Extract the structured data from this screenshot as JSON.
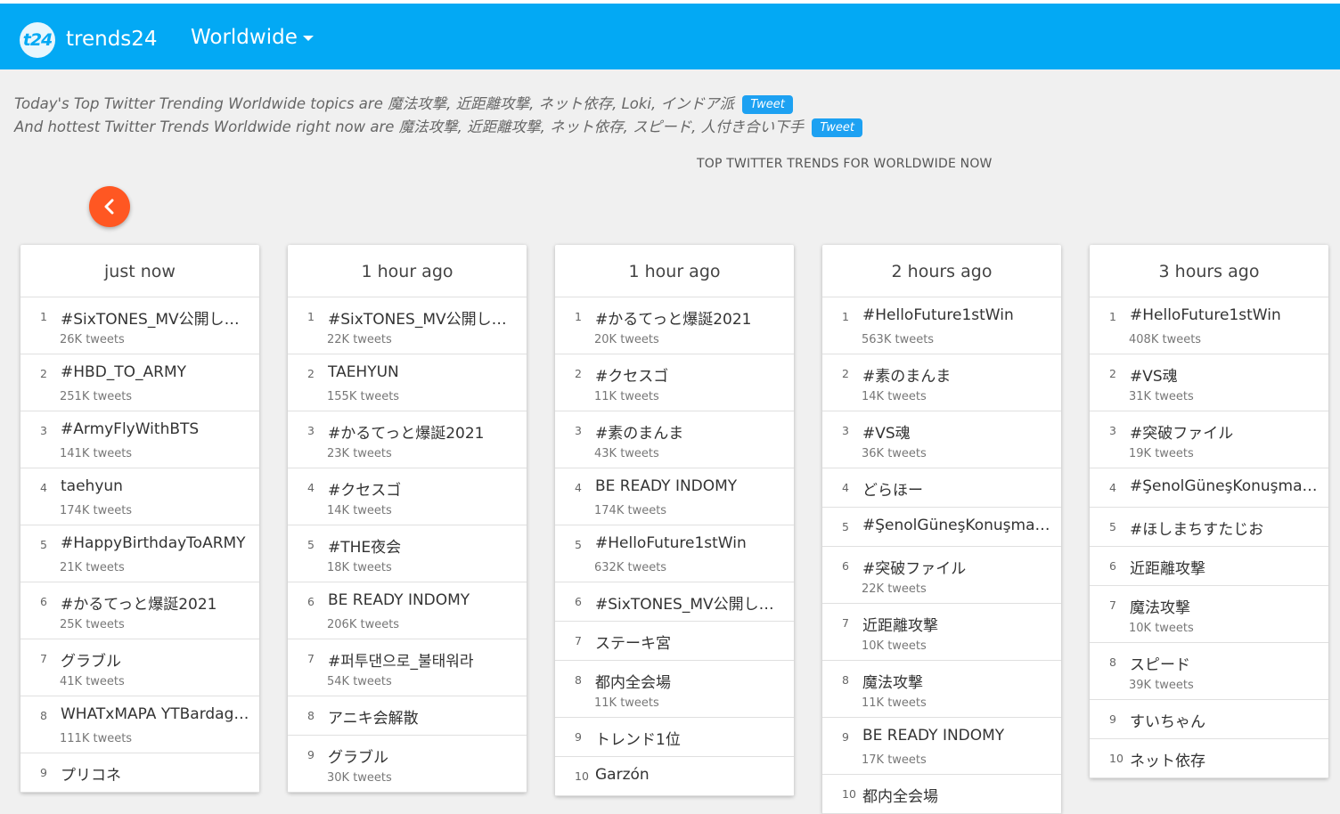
{
  "header": {
    "logo_text": "t24",
    "brand": "trends24",
    "region": "Worldwide"
  },
  "summary": {
    "line1": "Today's Top Twitter Trending Worldwide topics are 魔法攻撃, 近距離攻撃, ネット依存, Loki, インドア派",
    "line2": "And hottest Twitter Trends Worldwide right now are 魔法攻撃, 近距離攻撃, ネット依存, スピード, 人付き合い下手",
    "tweet_label": "Tweet"
  },
  "heading": "TOP TWITTER TRENDS FOR WORLDWIDE NOW",
  "columns": [
    {
      "title": "just now",
      "items": [
        {
          "rank": "1",
          "name": "#SixTONES_MV公開しマ...",
          "count": "26K tweets"
        },
        {
          "rank": "2",
          "name": "#HBD_TO_ARMY",
          "count": "251K tweets"
        },
        {
          "rank": "3",
          "name": "#ArmyFlyWithBTS",
          "count": "141K tweets"
        },
        {
          "rank": "4",
          "name": "taehyun",
          "count": "174K tweets"
        },
        {
          "rank": "5",
          "name": "#HappyBirthdayToARMY",
          "count": "21K tweets"
        },
        {
          "rank": "6",
          "name": "#かるてっと爆誕2021",
          "count": "25K tweets"
        },
        {
          "rank": "7",
          "name": "グラブル",
          "count": "41K tweets"
        },
        {
          "rank": "8",
          "name": "WHATxMAPA YTBardagulan",
          "count": "111K tweets"
        },
        {
          "rank": "9",
          "name": "プリコネ",
          "count": ""
        }
      ]
    },
    {
      "title": "1 hour ago",
      "items": [
        {
          "rank": "1",
          "name": "#SixTONES_MV公開しマ...",
          "count": "22K tweets"
        },
        {
          "rank": "2",
          "name": "TAEHYUN",
          "count": "155K tweets"
        },
        {
          "rank": "3",
          "name": "#かるてっと爆誕2021",
          "count": "23K tweets"
        },
        {
          "rank": "4",
          "name": "#クセスゴ",
          "count": "14K tweets"
        },
        {
          "rank": "5",
          "name": "#THE夜会",
          "count": "18K tweets"
        },
        {
          "rank": "6",
          "name": "BE READY INDOMY",
          "count": "206K tweets"
        },
        {
          "rank": "7",
          "name": "#퍼투댄으로_불태워라",
          "count": "54K tweets"
        },
        {
          "rank": "8",
          "name": "アニキ会解散",
          "count": ""
        },
        {
          "rank": "9",
          "name": "グラブル",
          "count": "30K tweets"
        }
      ]
    },
    {
      "title": "1 hour ago",
      "items": [
        {
          "rank": "1",
          "name": "#かるてっと爆誕2021",
          "count": "20K tweets"
        },
        {
          "rank": "2",
          "name": "#クセスゴ",
          "count": "11K tweets"
        },
        {
          "rank": "3",
          "name": "#素のまんま",
          "count": "43K tweets"
        },
        {
          "rank": "4",
          "name": "BE READY INDOMY",
          "count": "174K tweets"
        },
        {
          "rank": "5",
          "name": "#HelloFuture1stWin",
          "count": "632K tweets"
        },
        {
          "rank": "6",
          "name": "#SixTONES_MV公開しマ...",
          "count": ""
        },
        {
          "rank": "7",
          "name": "ステーキ宮",
          "count": ""
        },
        {
          "rank": "8",
          "name": "都内全会場",
          "count": "11K tweets"
        },
        {
          "rank": "9",
          "name": "トレンド1位",
          "count": ""
        },
        {
          "rank": "10",
          "name": "Garzón",
          "count": ""
        }
      ]
    },
    {
      "title": "2 hours ago",
      "items": [
        {
          "rank": "1",
          "name": "#HelloFuture1stWin",
          "count": "563K tweets"
        },
        {
          "rank": "2",
          "name": "#素のまんま",
          "count": "14K tweets"
        },
        {
          "rank": "3",
          "name": "#VS魂",
          "count": "36K tweets"
        },
        {
          "rank": "4",
          "name": "どらほー",
          "count": ""
        },
        {
          "rank": "5",
          "name": "#ŞenolGüneşKonuşmalısın",
          "count": ""
        },
        {
          "rank": "6",
          "name": "#突破ファイル",
          "count": "22K tweets"
        },
        {
          "rank": "7",
          "name": "近距離攻撃",
          "count": "10K tweets"
        },
        {
          "rank": "8",
          "name": "魔法攻撃",
          "count": "11K tweets"
        },
        {
          "rank": "9",
          "name": "BE READY INDOMY",
          "count": "17K tweets"
        },
        {
          "rank": "10",
          "name": "都内全会場",
          "count": ""
        }
      ]
    },
    {
      "title": "3 hours ago",
      "items": [
        {
          "rank": "1",
          "name": "#HelloFuture1stWin",
          "count": "408K tweets"
        },
        {
          "rank": "2",
          "name": "#VS魂",
          "count": "31K tweets"
        },
        {
          "rank": "3",
          "name": "#突破ファイル",
          "count": "19K tweets"
        },
        {
          "rank": "4",
          "name": "#ŞenolGüneşKonuşmalısın",
          "count": ""
        },
        {
          "rank": "5",
          "name": "#ほしまちすたじお",
          "count": ""
        },
        {
          "rank": "6",
          "name": "近距離攻撃",
          "count": ""
        },
        {
          "rank": "7",
          "name": "魔法攻撃",
          "count": "10K tweets"
        },
        {
          "rank": "8",
          "name": "スピード",
          "count": "39K tweets"
        },
        {
          "rank": "9",
          "name": "すいちゃん",
          "count": ""
        },
        {
          "rank": "10",
          "name": "ネット依存",
          "count": ""
        }
      ]
    }
  ]
}
